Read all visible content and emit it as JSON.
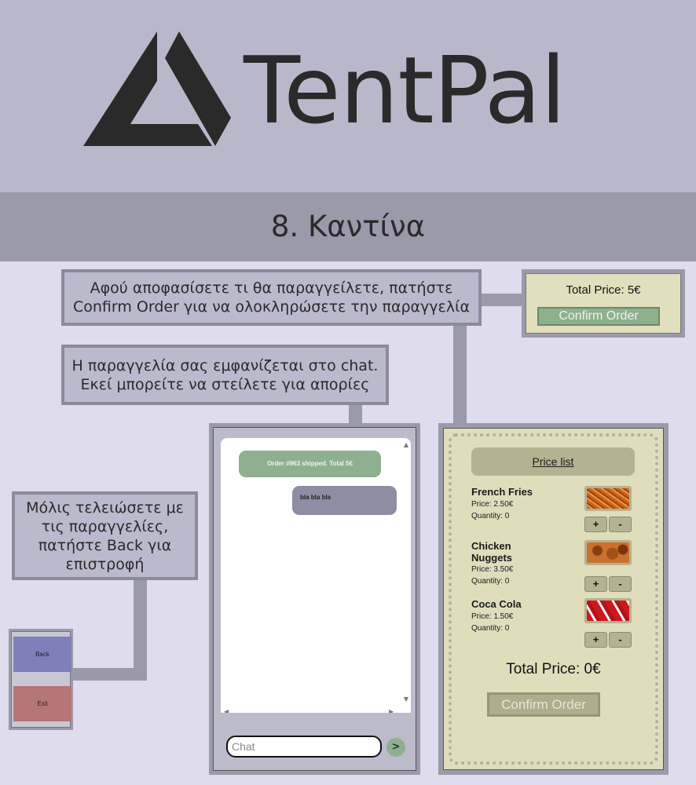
{
  "brand": {
    "name": "TentPal"
  },
  "section": {
    "title": "8. Καντίνα"
  },
  "callouts": {
    "confirm_line1": "Αφού αποφασίσετε τι θα παραγγείλετε, πατήστε",
    "confirm_line2": "Confirm Order για να ολοκληρώσετε την παραγγελία",
    "chat_line1": "Η παραγγελία σας εμφανίζεται στο chat.",
    "chat_line2": "Εκεί μπορείτε να στείλετε για απορίες",
    "back_line1": "Μόλις τελειώσετε με",
    "back_line2": "τις παραγγελίες,",
    "back_line3": "πατήστε Back για",
    "back_line4": "επιστροφή"
  },
  "preview_confirm": {
    "total": "Total Price: 5€",
    "button": "Confirm Order"
  },
  "nav": {
    "back": "Back",
    "exit": "Exit"
  },
  "chat": {
    "messages": [
      {
        "from": "system",
        "text": "Order #963 shipped. Total 5€"
      },
      {
        "from": "user",
        "text": "bla bla bla"
      }
    ],
    "input_placeholder": "Chat",
    "send_label": ">"
  },
  "canteen": {
    "price_list_label": "Price list",
    "items": [
      {
        "name_line1": "French Fries",
        "name_line2": "",
        "price": "Price: 2.50€",
        "quantity": "Quantity: 0",
        "image": "french-fries"
      },
      {
        "name_line1": "Chicken",
        "name_line2": "Nuggets",
        "price": "Price: 3.50€",
        "quantity": "Quantity: 0",
        "image": "chicken-nuggets"
      },
      {
        "name_line1": "Coca Cola",
        "name_line2": "",
        "price": "Price: 1.50€",
        "quantity": "Quantity: 0",
        "image": "coca-cola-cans"
      }
    ],
    "plus_label": "+",
    "minus_label": "-",
    "total": "Total Price: 0€",
    "confirm_label": "Confirm Order"
  },
  "colors": {
    "header_bg": "#b9b8cb",
    "section_bar_bg": "#9a9aab",
    "page_bg": "#dedced",
    "confirm_green": "#8fb08f",
    "back_blue": "#7f80ba",
    "exit_red": "#b67676",
    "canteen_bg": "#e0ddbd"
  }
}
